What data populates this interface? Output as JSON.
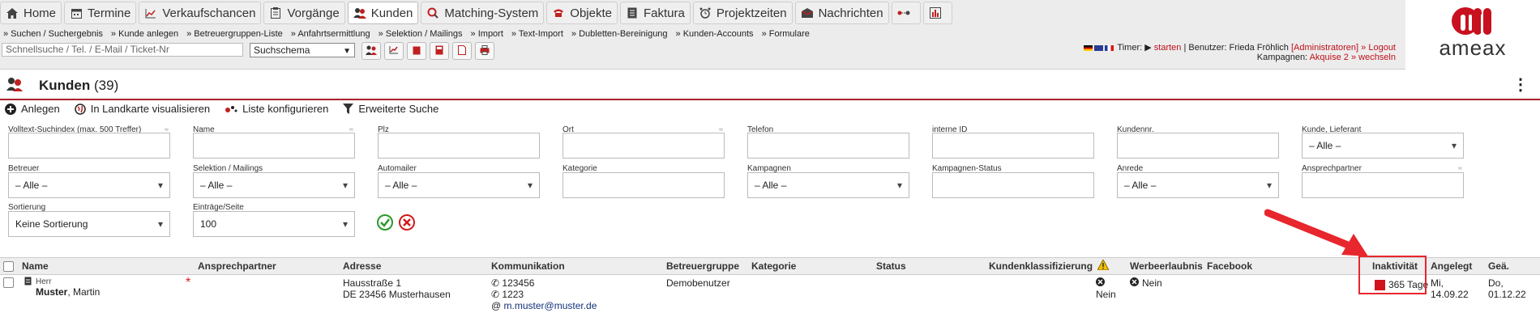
{
  "nav": {
    "items": [
      {
        "label": "Home",
        "icon": "home-icon"
      },
      {
        "label": "Termine",
        "icon": "calendar-icon"
      },
      {
        "label": "Verkaufschancen",
        "icon": "chart-line-icon"
      },
      {
        "label": "Vorgänge",
        "icon": "clipboard-icon"
      },
      {
        "label": "Kunden",
        "icon": "users-icon",
        "active": true
      },
      {
        "label": "Matching-System",
        "icon": "search-icon"
      },
      {
        "label": "Objekte",
        "icon": "phone-icon"
      },
      {
        "label": "Faktura",
        "icon": "document-icon"
      },
      {
        "label": "Projektzeiten",
        "icon": "alarm-clock-icon"
      },
      {
        "label": "Nachrichten",
        "icon": "envelope-icon"
      }
    ]
  },
  "subnav": [
    "» Suchen / Suchergebnis",
    "» Kunde anlegen",
    "» Betreuergruppen-Liste",
    "» Anfahrtsermittlung",
    "» Selektion / Mailings",
    "» Import",
    "» Text-Import",
    "» Dubletten-Bereinigung",
    "» Kunden-Accounts",
    "» Formulare"
  ],
  "quicksearch": {
    "placeholder": "Schnellsuche / Tel. / E-Mail / Ticket-Nr"
  },
  "schema": {
    "value": "Suchschema"
  },
  "status": {
    "timer_label": "Timer:",
    "timer_action": "starten",
    "user_label": "| Benutzer: Frieda Fröhlich",
    "role": "[Administratoren]",
    "logout": "» Logout",
    "campaign_label": "Kampagnen:",
    "campaign": "Akquise 2",
    "switch": "» wechseln"
  },
  "logo": {
    "text": "ameax"
  },
  "header": {
    "title": "Kunden",
    "count": "(39)"
  },
  "actions": [
    {
      "label": "Anlegen",
      "icon": "plus-circle-icon"
    },
    {
      "label": "In Landkarte visualisieren",
      "icon": "globe-icon"
    },
    {
      "label": "Liste konfigurieren",
      "icon": "settings-dots-icon"
    },
    {
      "label": "Erweiterte Suche",
      "icon": "filter-icon"
    }
  ],
  "filters": {
    "volltext": "Volltext-Suchindex (max. 500 Treffer)",
    "name": "Name",
    "plz": "Plz",
    "ort": "Ort",
    "telefon": "Telefon",
    "interne_id": "interne ID",
    "kundennr": "Kundennr.",
    "kunde_lieferant": "Kunde, Lieferant",
    "betreuer": "Betreuer",
    "selektion": "Selektion / Mailings",
    "automailer": "Automailer",
    "kategorie": "Kategorie",
    "kampagnen": "Kampagnen",
    "kampagnen_status": "Kampagnen-Status",
    "anrede": "Anrede",
    "ansprechpartner": "Ansprechpartner",
    "sortierung": "Sortierung",
    "eintraege": "Einträge/Seite",
    "alle": "– Alle –",
    "sort_value": "Keine Sortierung",
    "per_page": "100"
  },
  "table": {
    "headers": {
      "name": "Name",
      "ansprechpartner": "Ansprechpartner",
      "adresse": "Adresse",
      "kommunikation": "Kommunikation",
      "betreuergruppe": "Betreuergruppe",
      "kategorie": "Kategorie",
      "status": "Status",
      "kundenklass": "Kundenklassifizierung",
      "werbe": "Werbeerlaubnis",
      "facebook": "Facebook",
      "inaktiv": "Inaktivität",
      "angelegt": "Angelegt",
      "geae": "Geä."
    },
    "row": {
      "salutation": "Herr",
      "lastname": "Muster",
      "firstname": ", Martin",
      "star": "*",
      "street": "Hausstraße 1",
      "city": "DE 23456 Musterhausen",
      "phone1": "123456",
      "phone2": "1223",
      "email": "m.muster@muster.de",
      "group": "Demobenutzer",
      "klass": "Nein",
      "werbe": "Nein",
      "inaktiv": "365 Tage",
      "angelegt1": "Mi,",
      "angelegt2": "14.09.22",
      "geae1": "Do,",
      "geae2": "01.12.22"
    }
  },
  "colors": {
    "accent": "#a8212a",
    "highlight": "#e8262d",
    "inaktiv": "#d1141c"
  }
}
